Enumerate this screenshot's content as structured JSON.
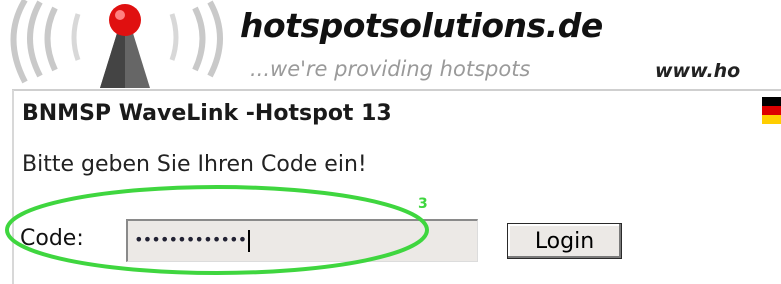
{
  "header": {
    "brand": "hotspotsolutions.de",
    "tagline": "...we're providing hotspots",
    "website": "www.ho"
  },
  "page": {
    "title": "BNMSP WaveLink -Hotspot 13",
    "prompt": "Bitte geben Sie Ihren Code ein!"
  },
  "form": {
    "code_label": "Code:",
    "code_value": "•••••••••••••",
    "login_label": "Login"
  },
  "annotation": {
    "step_number": "3",
    "color": "#3fd63f"
  },
  "flag_colors": [
    "#000000",
    "#dd0000",
    "#ffce00"
  ],
  "icons": [
    "antenna-logo-icon",
    "german-flag-icon"
  ]
}
